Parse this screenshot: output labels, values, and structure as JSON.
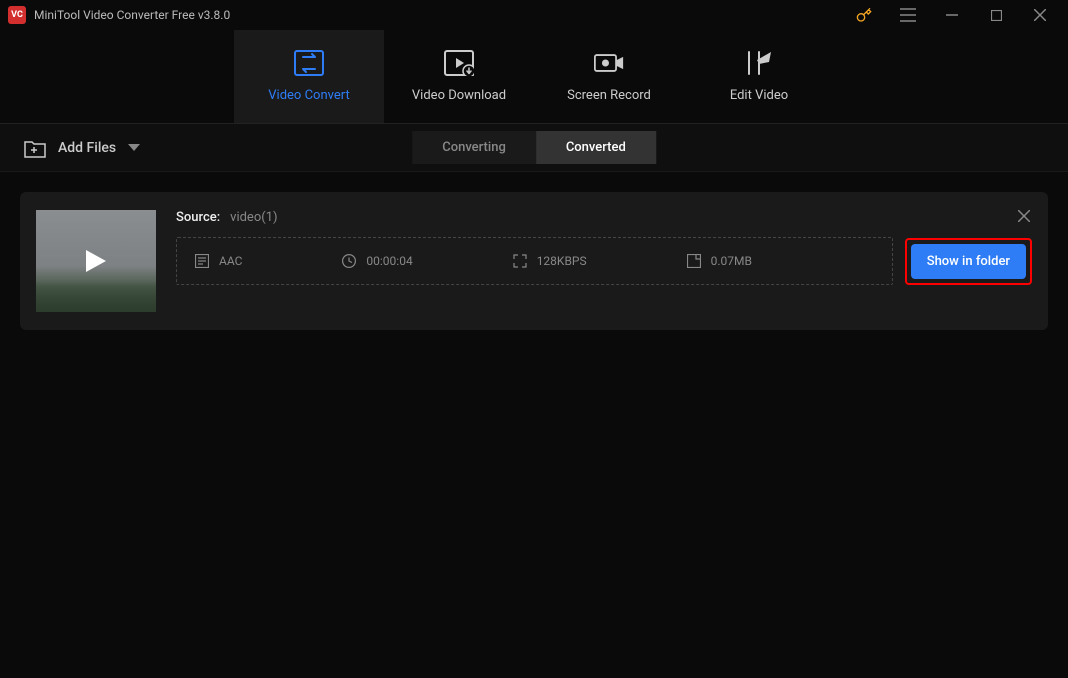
{
  "titlebar": {
    "app_logo_text": "VC",
    "title": "MiniTool Video Converter Free v3.8.0"
  },
  "nav": {
    "tabs": [
      {
        "label": "Video Convert"
      },
      {
        "label": "Video Download"
      },
      {
        "label": "Screen Record"
      },
      {
        "label": "Edit Video"
      }
    ]
  },
  "toolbar": {
    "add_files_label": "Add Files",
    "segments": {
      "converting": "Converting",
      "converted": "Converted"
    }
  },
  "item": {
    "source_label": "Source:",
    "source_value": "video(1)",
    "format": "AAC",
    "duration": "00:00:04",
    "bitrate": "128KBPS",
    "size": "0.07MB",
    "show_in_folder": "Show in folder"
  }
}
